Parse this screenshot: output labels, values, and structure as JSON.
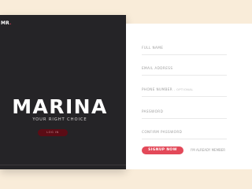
{
  "app": {
    "logo_text": "MR",
    "logo_accent": "."
  },
  "hero": {
    "title": "MARINA",
    "tagline": "YOUR RIGHT CHOICE",
    "login_label": "LOG IN"
  },
  "form": {
    "fields": [
      {
        "label": "FULL NAME",
        "suffix": ""
      },
      {
        "label": "EMAIL ADDRESS",
        "suffix": ""
      },
      {
        "label": "PHONE NUMBER",
        "suffix": "- OPTIONAL"
      },
      {
        "label": "PASSWORD",
        "suffix": ""
      },
      {
        "label": "CONFIRM PASSWORD",
        "suffix": ""
      }
    ],
    "signup_label": "SIGNUP NOW",
    "member_link": "I'M ALREADY MEMBER"
  },
  "colors": {
    "background": "#f9ecd9",
    "panel_dark": "#252427",
    "accent": "#e34959",
    "login_button": "#5b0c15"
  }
}
